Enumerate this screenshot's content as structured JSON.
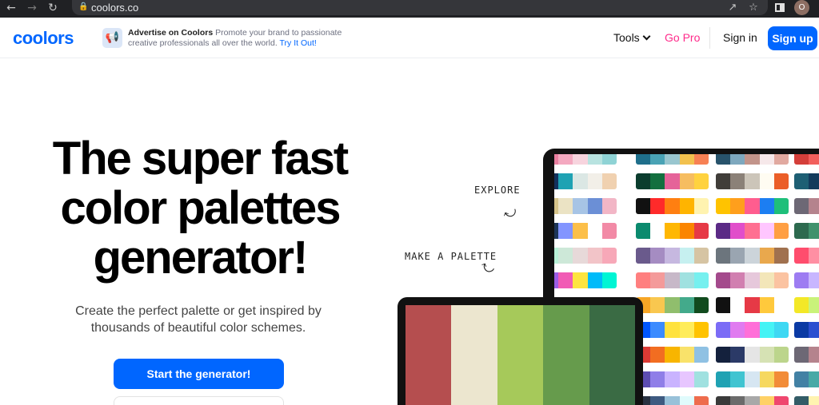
{
  "browser": {
    "url": "coolors.co",
    "back_icon": "arrow-left-icon",
    "forward_icon": "arrow-right-icon",
    "reload_icon": "reload-icon",
    "profile_initial": "O"
  },
  "header": {
    "logo": "coolors",
    "ad": {
      "title": "Advertise on Coolors",
      "text": "Promote your brand to passionate creative professionals all over the world.",
      "cta": "Try It Out!"
    },
    "nav": {
      "tools": "Tools",
      "gopro": "Go Pro",
      "signin": "Sign in",
      "signup": "Sign up"
    }
  },
  "hero": {
    "title_lines": [
      "The super fast",
      "color palettes",
      "generator!"
    ],
    "subtitle_lines": [
      "Create the perfect palette or get inspired by",
      "thousands of beautiful color schemes."
    ],
    "cta": "Start the generator!"
  },
  "annotations": {
    "explore": "EXPLORE",
    "make_palette": "MAKE A PALETTE"
  },
  "colors": {
    "accent": "#0066ff",
    "gopro": "#ff2a8a"
  },
  "laptop_palette": [
    "#b54e4f",
    "#ece6cf",
    "#a6c95a",
    "#669b4c",
    "#3a6b44"
  ],
  "tablet_palettes": [
    [
      [
        "#e97fa0",
        "#f4a9c0",
        "#f7d4de",
        "#b8e3e0",
        "#8fd3d5"
      ],
      [
        "#1f6f8b",
        "#4aa3b5",
        "#99c6cf",
        "#f2c14e",
        "#f78154"
      ],
      [
        "#28536b",
        "#7ea8be",
        "#c2948a",
        "#f6e8ea",
        "#e1a9a0"
      ],
      [
        "#d43f3a",
        "#f25f5c",
        "#ffe066",
        "#247ba0",
        "#70c1b3"
      ]
    ],
    [
      [
        "#13315c",
        "#1fa2b3",
        "#dbe7e4",
        "#f2efe8",
        "#f0d1b0"
      ],
      [
        "#0b3d2e",
        "#136f3f",
        "#e56399",
        "#f6bd60",
        "#ffd23f"
      ],
      [
        "#403d39",
        "#8b8178",
        "#ccc5b9",
        "#fffcf2",
        "#eb5e28"
      ],
      [
        "#1e5f74",
        "#133b5c",
        "#1d2d50",
        "#fcdab7",
        "#e6e6e6"
      ]
    ],
    [
      [
        "#d6c48b",
        "#ebe3c4",
        "#a7c4e5",
        "#6b8fd6",
        "#f2b6c6"
      ],
      [
        "#111111",
        "#ff2a2a",
        "#ff7f11",
        "#ffb400",
        "#fff3b0"
      ],
      [
        "#ffc300",
        "#ff9f1c",
        "#ff5d8f",
        "#1c7ef2",
        "#1fbf7a"
      ],
      [
        "#6d6875",
        "#b5838d",
        "#e5989b",
        "#ffb4a2",
        "#ffcdb2"
      ]
    ],
    [
      [
        "#1d3557",
        "#8395ff",
        "#fcbf49",
        "#ffffff",
        "#f28aa6"
      ],
      [
        "#0b8a6e",
        "#ffffff",
        "#ffb703",
        "#fb8500",
        "#e63946"
      ],
      [
        "#5b2a86",
        "#e14eca",
        "#ff6f91",
        "#ffc6ff",
        "#ff9f43"
      ],
      [
        "#2d6a4f",
        "#40916c",
        "#74c69d",
        "#95d5b2",
        "#d8f3dc"
      ]
    ],
    [
      [
        "#b8f2d8",
        "#cde8d8",
        "#e7d9d9",
        "#f2c4c8",
        "#f7a8b8"
      ],
      [
        "#6a5a8c",
        "#a58cc2",
        "#c6b8e0",
        "#c6f0f0",
        "#d6c4a3"
      ],
      [
        "#6c757d",
        "#9aa5b1",
        "#ccd4da",
        "#e9a84d",
        "#a0714f"
      ],
      [
        "#ff4d6d",
        "#ff8fa3",
        "#ffb3c1",
        "#ffccd5",
        "#fff0f3"
      ]
    ],
    [
      [
        "#9b5de5",
        "#f15bb5",
        "#fee440",
        "#00bbf9",
        "#00f5d4"
      ],
      [
        "#ff7f7f",
        "#f49a9a",
        "#c7b8c8",
        "#a0e1e0",
        "#76f0ef"
      ],
      [
        "#a44a8c",
        "#d17fb0",
        "#e6c8db",
        "#f3e6b9",
        "#fbc3a1"
      ],
      [
        "#9d7cf2",
        "#c8b6ff",
        "#b8c0ff",
        "#bbd0ff",
        "#e7c6ff"
      ]
    ],
    [
      [
        "#0a2463",
        "#3e92cc",
        "#fffaff",
        "#d8315b",
        "#1e1b18"
      ],
      [
        "#f7a626",
        "#f9c74f",
        "#90be6d",
        "#43aa8b",
        "#114b1e"
      ],
      [
        "#111111",
        "#ffffff",
        "#e63946",
        "#ffc93c",
        "#ffffff"
      ],
      [
        "#f3e827",
        "#c9f27a",
        "#7de39b",
        "#3ac7b5",
        "#2a9d8f"
      ]
    ],
    [
      [
        "#1560bd",
        "#2d9cdb",
        "#f9e20e",
        "#ffd60a",
        "#ffbf00"
      ],
      [
        "#0056ff",
        "#3b8bff",
        "#ffe23e",
        "#ffec5a",
        "#ffc300"
      ],
      [
        "#7b6cf6",
        "#e07bf0",
        "#ff6fd8",
        "#44f3f5",
        "#3ed8f3"
      ],
      [
        "#0b3aa4",
        "#2b4fd0",
        "#e3e7ef",
        "#f4e9a1",
        "#d7e8b4"
      ]
    ],
    [
      [
        "#a7826d",
        "#cfae8b",
        "#f4d3b0",
        "#f8f1e5",
        "#c8b6f0"
      ],
      [
        "#db3a34",
        "#f26d21",
        "#f8b500",
        "#f9e26a",
        "#8fc1e3"
      ],
      [
        "#14213d",
        "#2b3a67",
        "#e5e5e5",
        "#d6e2b4",
        "#bcd58c"
      ],
      [
        "#6d6875",
        "#b5838d",
        "#e5989b",
        "#ffb4a2",
        "#ffcdb2"
      ]
    ],
    [
      [
        "#1f6f8b",
        "#4aa3b5",
        "#8fd3d5",
        "#f6d860",
        "#f7a541"
      ],
      [
        "#5c4db1",
        "#8f7ee8",
        "#c9b3ff",
        "#e7c6ff",
        "#a0e1e0"
      ],
      [
        "#1fa2b3",
        "#40c4d1",
        "#d6e6f2",
        "#f6d860",
        "#f28c38"
      ],
      [
        "#4281a4",
        "#48a9a6",
        "#e4dfda",
        "#d4b483",
        "#c1666b"
      ]
    ],
    [
      [
        "#2d3142",
        "#4f5d75",
        "#bfc0c0",
        "#ffffff",
        "#ef8354"
      ],
      [
        "#293241",
        "#3d5a80",
        "#98c1d9",
        "#e0fbfc",
        "#ee6c4d"
      ],
      [
        "#3a3a3a",
        "#6b6b6b",
        "#a8a8a8",
        "#ffd166",
        "#ef476f"
      ],
      [
        "#335c67",
        "#fff3b0",
        "#e09f3e",
        "#9e2a2b",
        "#540b0e"
      ]
    ]
  ]
}
